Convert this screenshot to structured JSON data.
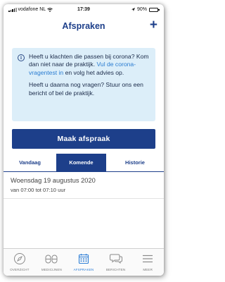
{
  "status_bar": {
    "carrier": "vodafone NL",
    "time": "17:39",
    "battery": "90%",
    "battery_level": 0.9
  },
  "header": {
    "title": "Afspraken",
    "add_label": "+"
  },
  "info": {
    "icon": "info-icon",
    "paragraph1_text": "Heeft u klachten die passen bij corona? Kom dan niet naar de praktijk. ",
    "paragraph1_link": "Vul de corona-vragentest in",
    "paragraph1_tail": " en volg het advies op.",
    "paragraph2": "Heeft u daarna nog vragen? Stuur ons een bericht of bel de praktijk."
  },
  "primary_button": "Maak afspraak",
  "tabs": [
    {
      "label": "Vandaag",
      "active": false
    },
    {
      "label": "Komende",
      "active": true
    },
    {
      "label": "Historie",
      "active": false
    }
  ],
  "appointment": {
    "date": "Woensdag 19 augustus 2020",
    "time": "van 07:00 tot 07:10 uur"
  },
  "bottom_nav": [
    {
      "label": "OVERZICHT",
      "icon": "compass-icon",
      "active": false
    },
    {
      "label": "MEDICIJNEN",
      "icon": "pills-icon",
      "active": false
    },
    {
      "label": "AFSPRAKEN",
      "icon": "calendar-icon",
      "active": true
    },
    {
      "label": "BERICHTEN",
      "icon": "chat-icon",
      "active": false
    },
    {
      "label": "MEER",
      "icon": "menu-icon",
      "active": false
    }
  ],
  "colors": {
    "brand": "#1d3f8a",
    "info_bg": "#dceef9",
    "link": "#2a7cd1",
    "active_nav": "#2f7fd6"
  }
}
